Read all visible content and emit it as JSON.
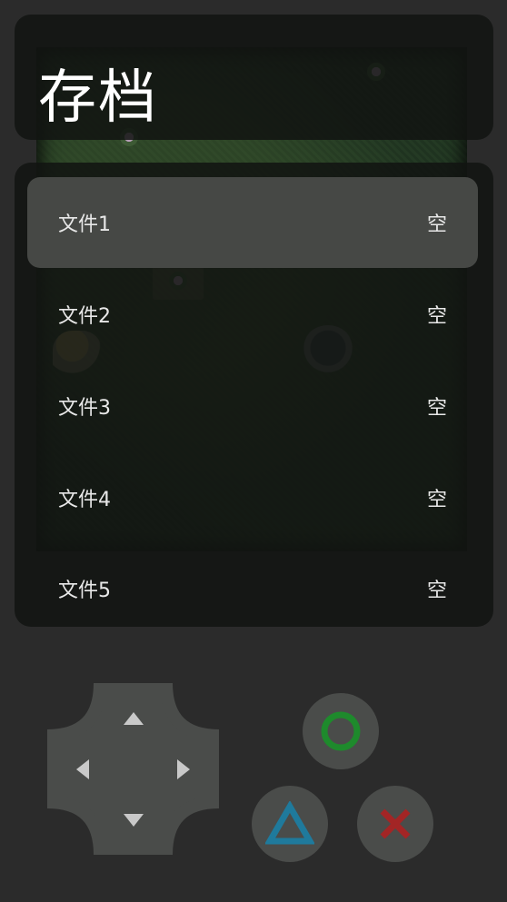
{
  "title": "存档",
  "save_slots": [
    {
      "label": "文件1",
      "status": "空",
      "selected": true
    },
    {
      "label": "文件2",
      "status": "空",
      "selected": false
    },
    {
      "label": "文件3",
      "status": "空",
      "selected": false
    },
    {
      "label": "文件4",
      "status": "空",
      "selected": false
    },
    {
      "label": "文件5",
      "status": "空",
      "selected": false
    }
  ],
  "controls": {
    "dpad_icons": [
      "arrow-up-icon",
      "arrow-down-icon",
      "arrow-left-icon",
      "arrow-right-icon"
    ],
    "buttons": [
      {
        "name": "circle",
        "icon": "circle-icon",
        "color": "#1e8a2c"
      },
      {
        "name": "triangle",
        "icon": "triangle-icon",
        "color": "#1f7a9c"
      },
      {
        "name": "cross",
        "icon": "cross-icon",
        "color": "#a32525"
      }
    ]
  },
  "colors": {
    "background": "#2b2b2b",
    "panel": "#121412",
    "selected_slot": "#464845",
    "button": "#4a4c4a",
    "dpad": "#4a4c4a"
  }
}
